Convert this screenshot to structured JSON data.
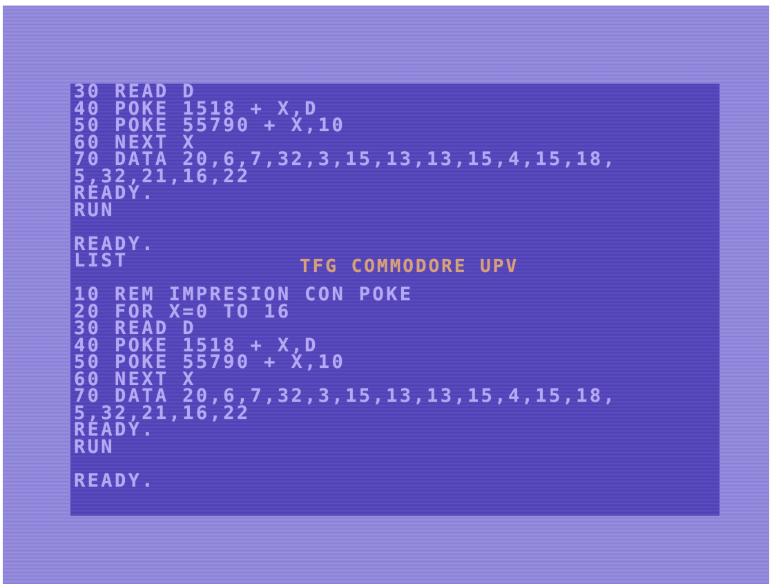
{
  "screen": {
    "lines": [
      "30 READ D",
      "40 POKE 1518 + X,D",
      "50 POKE 55790 + X,10",
      "60 NEXT X",
      "70 DATA 20,6,7,32,3,15,13,13,15,4,15,18,",
      "5,32,21,16,22",
      "READY.",
      "RUN",
      "",
      "READY.",
      "LIST",
      "",
      "10 REM IMPRESION CON POKE",
      "20 FOR X=0 TO 16",
      "30 READ D",
      "40 POKE 1518 + X,D",
      "50 POKE 55790 + X,10",
      "60 NEXT X",
      "70 DATA 20,6,7,32,3,15,13,13,15,4,15,18,",
      "5,32,21,16,22",
      "READY.",
      "RUN",
      "",
      "READY."
    ],
    "overlay_title": "TFG COMMODORE UPV"
  },
  "colors": {
    "border": "#9289e0",
    "screen_background": "#5646c0",
    "text": "#b4aaf4",
    "overlay_text": "#d7a07a"
  }
}
